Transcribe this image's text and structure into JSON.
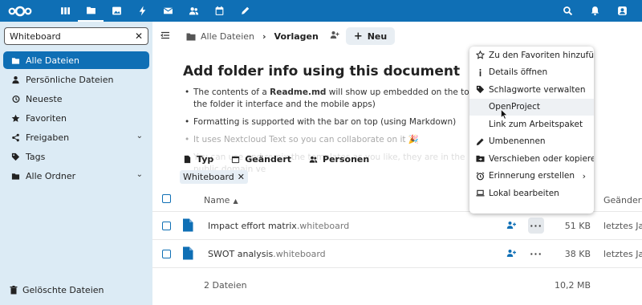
{
  "header": {
    "apps": [
      {
        "name": "dashboard-icon"
      },
      {
        "name": "files-icon",
        "active": true
      },
      {
        "name": "photos-icon"
      },
      {
        "name": "activity-icon"
      },
      {
        "name": "mail-icon"
      },
      {
        "name": "contacts-icon"
      },
      {
        "name": "calendar-icon"
      },
      {
        "name": "notes-icon"
      }
    ],
    "right": [
      "search-icon",
      "notifications-icon",
      "user-menu-icon"
    ]
  },
  "sidebar": {
    "search_value": "Whiteboard",
    "items": [
      {
        "label": "Alle Dateien",
        "icon": "folder-icon",
        "active": true
      },
      {
        "label": "Persönliche Dateien",
        "icon": "user-icon"
      },
      {
        "label": "Neueste",
        "icon": "history-icon"
      },
      {
        "label": "Favoriten",
        "icon": "star-icon"
      },
      {
        "label": "Freigaben",
        "icon": "share-icon",
        "expandable": true
      },
      {
        "label": "Tags",
        "icon": "tag-icon"
      },
      {
        "label": "Alle Ordner",
        "icon": "folder-icon",
        "expandable": true
      }
    ],
    "trash_label": "Gelöschte Dateien"
  },
  "breadcrumb": {
    "root": "Alle Dateien",
    "current": "Vorlagen",
    "new_label": "Neu"
  },
  "readme": {
    "title": "Add folder info using this document",
    "bullets": [
      {
        "pre": "The contents of a ",
        "bold": "Readme.md",
        "post": " will show up embedded on the top of the folder it interface and the mobile apps)"
      },
      {
        "pre": "Formatting is supported with the bar on top (using Markdown)",
        "bold": "",
        "post": ""
      },
      {
        "pre": "It uses Nextcloud Text so you can collaborate on it 🎉",
        "bold": "",
        "post": ""
      },
      {
        "pre": "You can use and remix the templates as you like, they are in the public domain ve",
        "bold": "",
        "post": ""
      }
    ]
  },
  "filters": {
    "type": "Typ",
    "modified": "Geändert",
    "people": "Personen",
    "active_chip": "Whiteboard"
  },
  "table": {
    "col_name": "Name",
    "col_modified": "Geändert",
    "rows": [
      {
        "name": "Impact effort matrix",
        "ext": ".whiteboard",
        "size": "51 KB",
        "modified": "letztes Jahr"
      },
      {
        "name": "SWOT analysis",
        "ext": ".whiteboard",
        "size": "38 KB",
        "modified": "letztes Jahr"
      }
    ],
    "summary": "2 Dateien",
    "summary_size": "10,2 MB"
  },
  "context_menu": {
    "items": [
      {
        "label": "Zu den Favoriten hinzufügen",
        "icon": "star-outline-icon"
      },
      {
        "label": "Details öffnen",
        "icon": "info-icon"
      },
      {
        "label": "Schlagworte verwalten",
        "icon": "tag-icon"
      },
      {
        "label": "OpenProject",
        "icon": "",
        "hover": true
      },
      {
        "label": "Link zum Arbeitspaket",
        "icon": ""
      },
      {
        "label": "Umbenennen",
        "icon": "pencil-icon"
      },
      {
        "label": "Verschieben oder kopieren",
        "icon": "folder-move-icon"
      },
      {
        "label": "Erinnerung erstellen",
        "icon": "alarm-icon",
        "submenu": true
      },
      {
        "label": "Lokal bearbeiten",
        "icon": "laptop-icon"
      }
    ]
  },
  "colors": {
    "primary": "#0f6fb5",
    "sidebar_bg": "#dcebf5"
  }
}
